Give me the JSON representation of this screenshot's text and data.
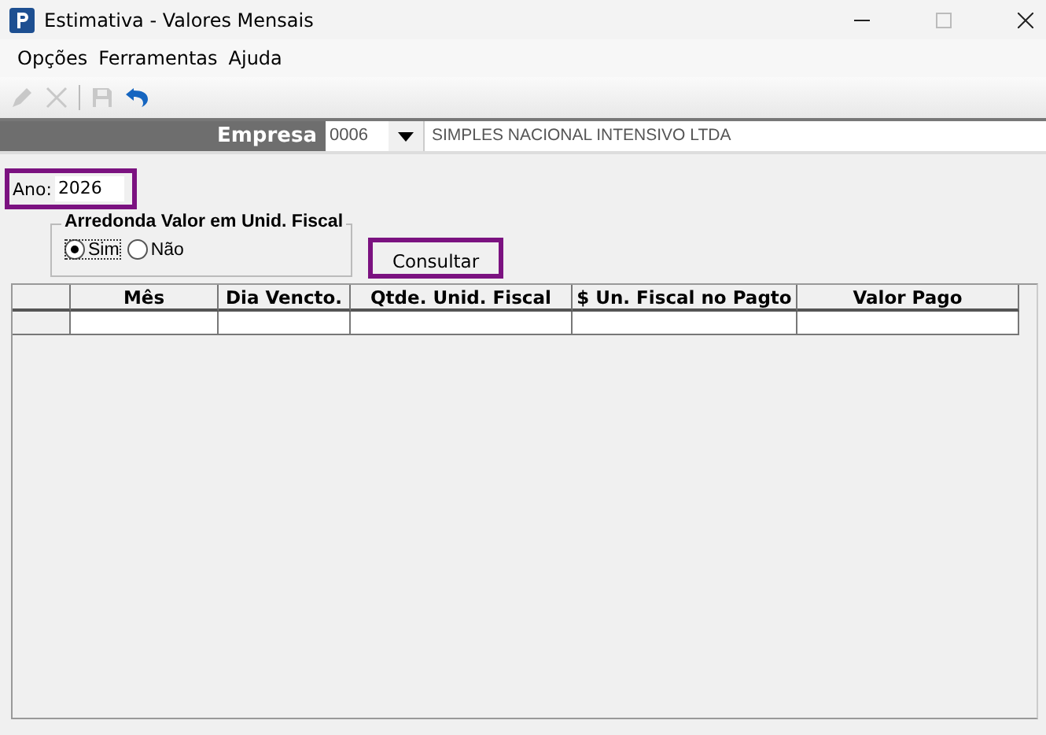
{
  "window": {
    "title": "Estimativa - Valores Mensais"
  },
  "menu": [
    "Opções",
    "Ferramentas",
    "Ajuda"
  ],
  "toolbar": [
    {
      "kind": "edit",
      "disabled": true
    },
    {
      "kind": "delete",
      "disabled": true
    },
    {
      "kind": "save",
      "disabled": true
    },
    {
      "kind": "undo",
      "disabled": false
    }
  ],
  "empresa": {
    "label": "Empresa",
    "code": "0006",
    "name": "SIMPLES NACIONAL INTENSIVO LTDA"
  },
  "ano": {
    "label": "Ano:",
    "value": "2026"
  },
  "arredonda": {
    "title": "Arredonda Valor em Unid. Fiscal",
    "options": [
      {
        "label": "Sim",
        "selected": true
      },
      {
        "label": "Não",
        "selected": false
      }
    ]
  },
  "consultar": "Consultar",
  "table": {
    "columns": [
      "Mês",
      "Dia Vencto.",
      "Qtde. Unid. Fiscal",
      "$ Un. Fiscal no Pagto",
      "Valor Pago"
    ]
  }
}
